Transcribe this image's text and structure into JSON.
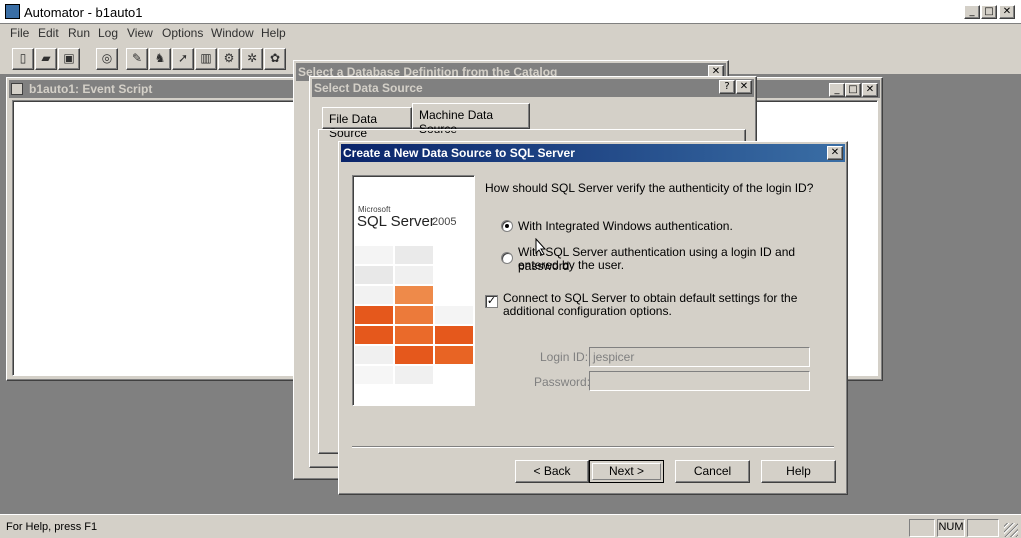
{
  "app": {
    "title": "Automator - b1auto1",
    "menu": [
      "File",
      "Edit",
      "Run",
      "Log",
      "View",
      "Options",
      "Window",
      "Help"
    ]
  },
  "event_window": {
    "title": "b1auto1: Event Script"
  },
  "catalog_dialog": {
    "title": "Select a Database Definition from the Catalog"
  },
  "select_ds_dialog": {
    "title": "Select Data Source",
    "tabs": [
      "File Data Source",
      "Machine Data Source"
    ],
    "active_tab": "Machine Data Source"
  },
  "create_ds_dialog": {
    "title": "Create a New Data Source to SQL Server",
    "brand": {
      "line1": "Microsoft",
      "line2": "SQL Server",
      "line3": "2005"
    },
    "question": "How should SQL Server verify the authenticity of the login ID?",
    "radio_windows": "With Integrated Windows authentication.",
    "radio_sql_line1": "With SQL Server authentication using a login ID and password",
    "radio_sql_line2": "entered by the user.",
    "checkbox_line1": "Connect to SQL Server to obtain default settings for the",
    "checkbox_line2": "additional configuration options.",
    "login_label": "Login ID:",
    "login_value": "jespicer",
    "password_label": "Password:",
    "password_value": "",
    "buttons": {
      "back": "< Back",
      "next": "Next >",
      "cancel": "Cancel",
      "help": "Help"
    },
    "colors": {
      "title_start": "#0a246a",
      "title_end": "#3a6ea5",
      "tile_orange": "#e5581c"
    }
  },
  "status": {
    "text": "For Help, press F1",
    "num": "NUM"
  }
}
